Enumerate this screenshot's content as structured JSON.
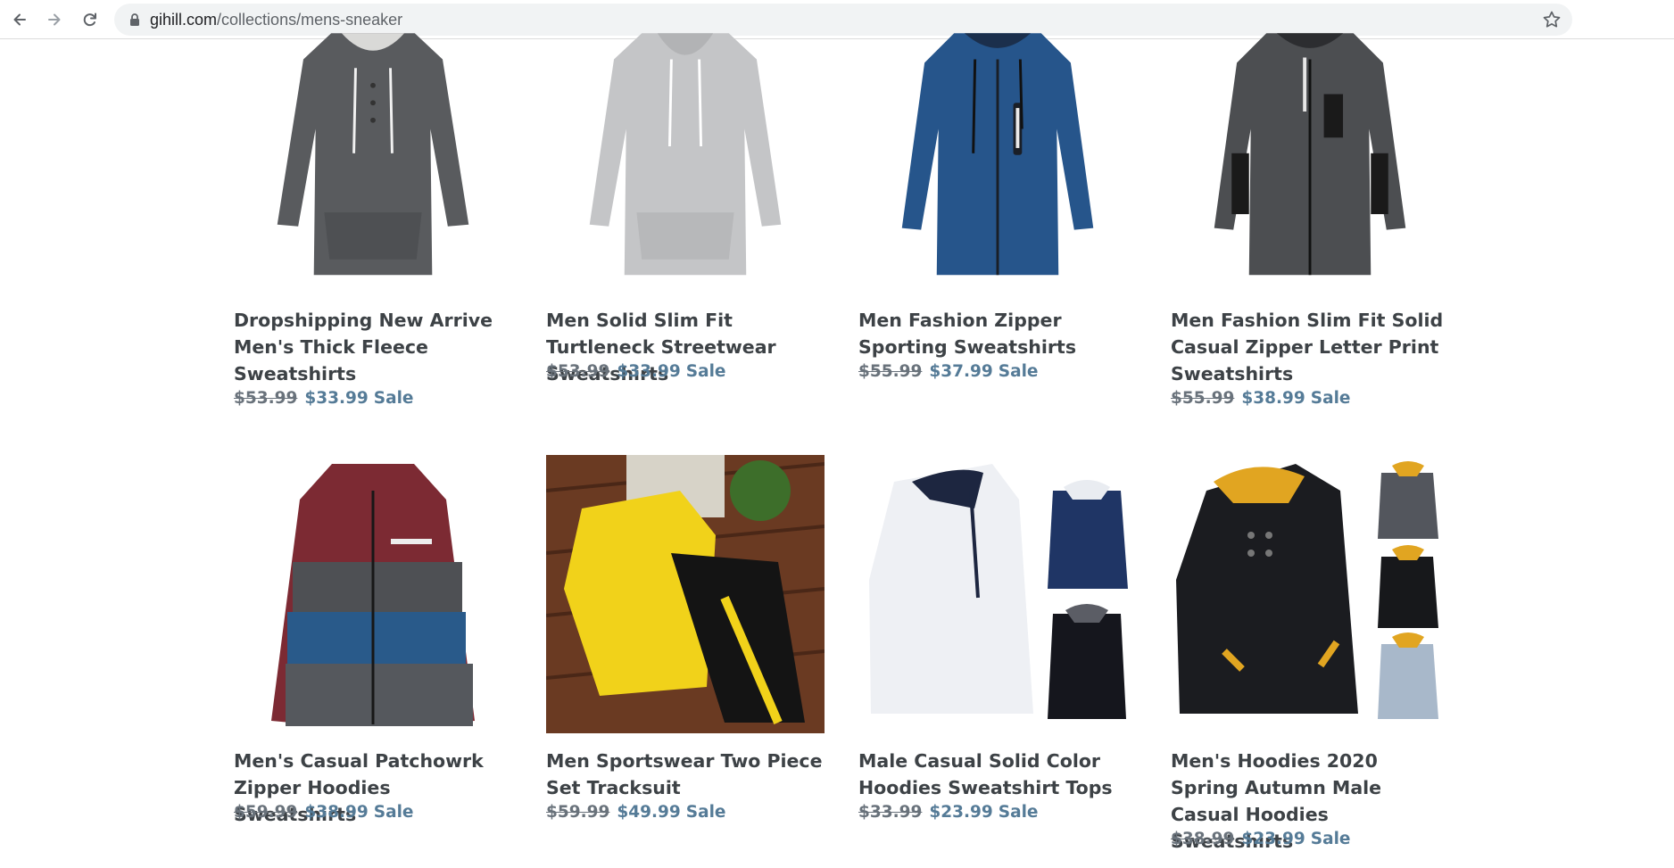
{
  "browser": {
    "url_domain": "gihill.com",
    "url_path": "/collections/mens-sneaker"
  },
  "products": [
    {
      "title": "Dropshipping New Arrive Men's Thick Fleece Sweatshirts",
      "old_price": "$53.99",
      "price": "$33.99",
      "sale": "Sale",
      "image": "dark-gray-pullover-hoodie",
      "color": "#5a5c5f"
    },
    {
      "title": "Men Solid Slim Fit Turtleneck Streetwear Sweatshirts",
      "old_price": "$53.99",
      "price": "$33.99",
      "sale": "Sale",
      "image": "light-gray-pullover-hoodie",
      "color": "#c6c7c9"
    },
    {
      "title": "Men Fashion Zipper Sporting Sweatshirts",
      "old_price": "$55.99",
      "price": "$37.99",
      "sale": "Sale",
      "image": "blue-zip-hoodie",
      "color": "#24548a"
    },
    {
      "title": "Men Fashion Slim Fit Solid Casual Zipper Letter Print Sweatshirts",
      "old_price": "$55.99",
      "price": "$38.99",
      "sale": "Sale",
      "image": "charcoal-zip-hoodie",
      "color": "#4b4d50"
    },
    {
      "title": "Men's Casual Patchowrk Zipper Hoodies Sweatshirts",
      "old_price": "$59.99",
      "price": "$38.99",
      "sale": "Sale",
      "image": "patchwork-zip-hoodie",
      "color": "#7d2a34"
    },
    {
      "title": "Men Sportswear Two Piece Set Tracksuit",
      "old_price": "$59.99",
      "price": "$49.99",
      "sale": "Sale",
      "image": "yellow-black-tracksuit",
      "color": "#f2d51c"
    },
    {
      "title": "Male Casual Solid Color Hoodies Sweatshirt Tops",
      "old_price": "$33.99",
      "price": "$23.99",
      "sale": "Sale",
      "image": "white-navy-hoodies",
      "color": "#f2f4f8"
    },
    {
      "title": "Men's Hoodies 2020 Spring Autumn Male Casual Hoodies Sweatshirts",
      "old_price": "$38.99",
      "price": "$23.99",
      "sale": "Sale",
      "image": "black-yellow-hoodies",
      "color": "#1c1d21"
    }
  ]
}
